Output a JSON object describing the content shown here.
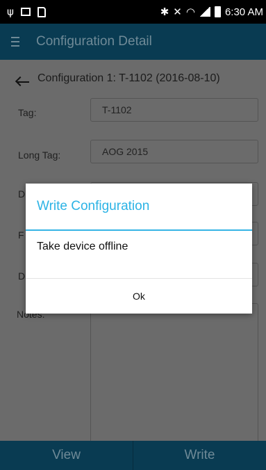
{
  "status_bar": {
    "time": "6:30 AM",
    "icons": [
      "usb-icon",
      "image-icon",
      "sd-card-icon",
      "bluetooth-icon",
      "mute-icon",
      "wifi-icon",
      "signal-icon",
      "battery-charging-icon"
    ]
  },
  "app_bar": {
    "title": "Configuration Detail",
    "menu_icon": "hamburger-menu-icon"
  },
  "configuration": {
    "heading": "Configuration 1: T-1102  (2016-08-10)",
    "back_icon": "back-arrow-icon",
    "fields": [
      {
        "label": "Tag:",
        "value": "T-1102"
      },
      {
        "label": "Long Tag:",
        "value": "AOG 2015"
      }
    ],
    "partial_labels": [
      "D",
      "F",
      "D",
      "N",
      "otes:"
    ]
  },
  "dialog": {
    "title": "Write Configuration",
    "message": "Take device offline",
    "ok_label": "Ok"
  },
  "bottom_bar": {
    "view_label": "View",
    "write_label": "Write"
  },
  "colors": {
    "app_bar": "#093B52",
    "dialog_accent": "#2CB3E5",
    "dimmed_background": "#6B6B6B"
  }
}
